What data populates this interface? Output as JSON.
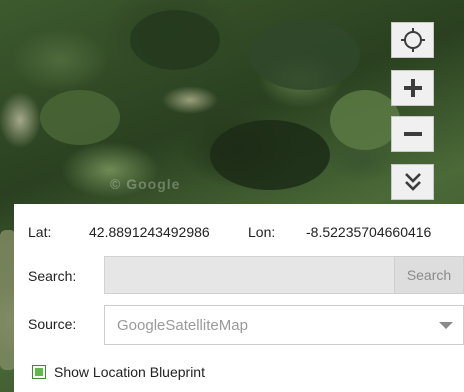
{
  "map": {
    "watermark": "© Google",
    "controls": {
      "locate_icon": "crosshair-icon",
      "zoom_in_icon": "plus-icon",
      "zoom_out_icon": "minus-icon",
      "collapse_icon": "double-chevron-down-icon"
    }
  },
  "coords": {
    "lat_label": "Lat:",
    "lat_value": "42.8891243492986",
    "lon_label": "Lon:",
    "lon_value": "-8.52235704660416"
  },
  "search": {
    "label": "Search:",
    "value": "",
    "button_label": "Search"
  },
  "source": {
    "label": "Source:",
    "selected": "GoogleSatelliteMap"
  },
  "blueprint": {
    "label": "Show Location Blueprint",
    "checked": true
  },
  "colors": {
    "checkbox": "#5fb84a",
    "control_bg": "#f0f0f0"
  }
}
